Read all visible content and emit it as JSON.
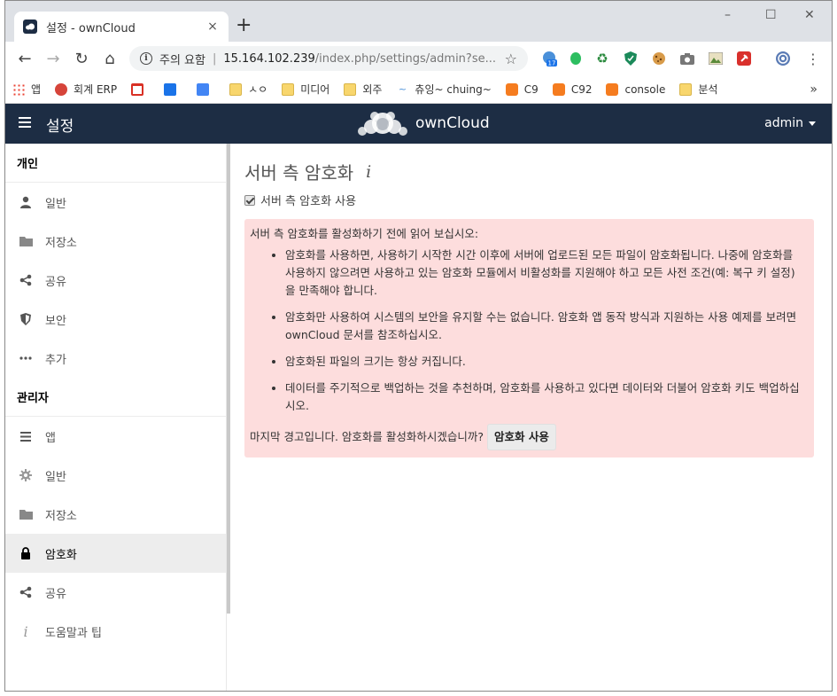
{
  "browser": {
    "tab_title": "설정 - ownCloud",
    "tab_close": "×",
    "new_tab": "+",
    "security_label": "주의 요함",
    "url_host": "15.164.102.239",
    "url_path": "/index.php/settings/admin?se...",
    "window_controls": [
      "–",
      "☐",
      "✕"
    ],
    "bookmarks": [
      {
        "label": "앱",
        "icon": "apps-grid-icon"
      },
      {
        "label": "회계 ERP",
        "icon": "erp-icon"
      },
      {
        "label": "",
        "icon": "gmail-icon"
      },
      {
        "label": "",
        "icon": "calendar-icon"
      },
      {
        "label": "",
        "icon": "translate-icon"
      },
      {
        "label": "ㅅㅇ",
        "icon": "folder-icon"
      },
      {
        "label": "미디어",
        "icon": "folder-icon"
      },
      {
        "label": "외주",
        "icon": "folder-icon"
      },
      {
        "label": "츄잉~ chuing~",
        "icon": "chuing-icon"
      },
      {
        "label": "C9",
        "icon": "aws-cube-icon"
      },
      {
        "label": "C92",
        "icon": "aws-cube-icon"
      },
      {
        "label": "console",
        "icon": "aws-cube-icon"
      },
      {
        "label": "분석",
        "icon": "folder-icon"
      }
    ],
    "bookmarks_more": "»",
    "extension_badge": "17"
  },
  "app": {
    "header_title": "설정",
    "logo_text": "ownCloud",
    "user": "admin"
  },
  "sidebar": {
    "personal_heading": "개인",
    "personal_items": [
      {
        "label": "일반",
        "icon": "user-icon"
      },
      {
        "label": "저장소",
        "icon": "folder-icon"
      },
      {
        "label": "공유",
        "icon": "share-icon"
      },
      {
        "label": "보안",
        "icon": "shield-icon"
      },
      {
        "label": "추가",
        "icon": "more-icon"
      }
    ],
    "admin_heading": "관리자",
    "admin_items": [
      {
        "label": "앱",
        "icon": "list-icon"
      },
      {
        "label": "일반",
        "icon": "gear-icon"
      },
      {
        "label": "저장소",
        "icon": "folder-icon"
      },
      {
        "label": "암호화",
        "icon": "lock-icon",
        "active": true
      },
      {
        "label": "공유",
        "icon": "share-icon"
      },
      {
        "label": "도움말과 팁",
        "icon": "info-icon"
      }
    ]
  },
  "main": {
    "page_title": "서버 측 암호화",
    "enable_checkbox_label": "서버 측 암호화 사용",
    "enable_checked": true,
    "warning_intro": "서버 측 암호화를 활성화하기 전에 읽어 보십시오:",
    "warning_items": [
      "암호화를 사용하면, 사용하기 시작한 시간 이후에 서버에 업로드된 모든 파일이 암호화됩니다. 나중에 암호화를 사용하지 않으려면 사용하고 있는 암호화 모듈에서 비활성화를 지원해야 하고 모든 사전 조건(예: 복구 키 설정)을 만족해야 합니다.",
      "암호화만 사용하여 시스템의 보안을 유지할 수는 없습니다. 암호화 앱 동작 방식과 지원하는 사용 예제를 보려면 ownCloud 문서를 참조하십시오.",
      "암호화된 파일의 크기는 항상 커집니다.",
      "데이터를 주기적으로 백업하는 것을 추천하며, 암호화를 사용하고 있다면 데이터와 더불어 암호화 키도 백업하십시오."
    ],
    "final_warning": "마지막 경고입니다. 암호화를 활성화하시겠습니까?",
    "enable_button": "암호화 사용"
  },
  "colors": {
    "header_bg": "#1d2d44",
    "warning_bg": "#fddddd",
    "active_nav_bg": "#ededed"
  }
}
